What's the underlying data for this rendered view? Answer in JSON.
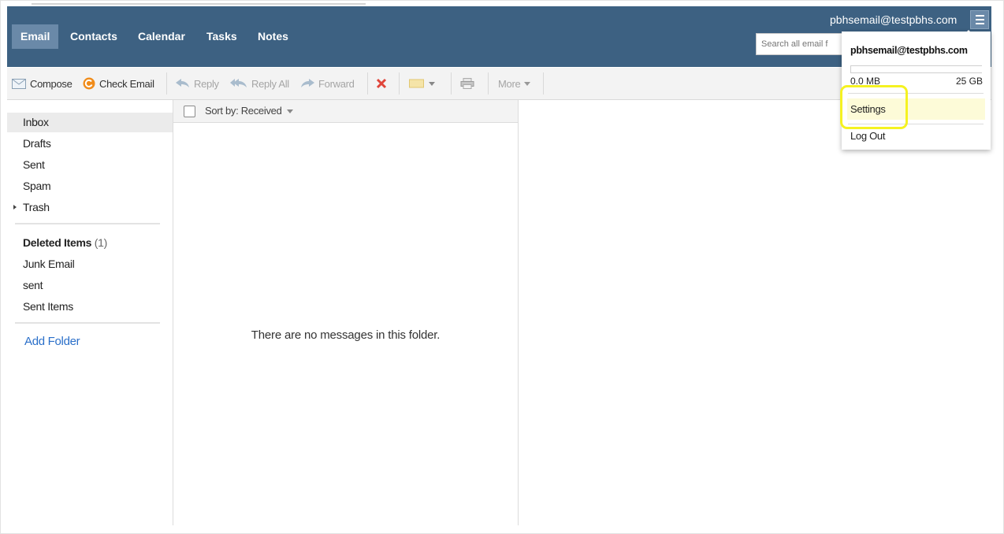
{
  "header": {
    "tabs": [
      {
        "label": "Email",
        "active": true
      },
      {
        "label": "Contacts",
        "active": false
      },
      {
        "label": "Calendar",
        "active": false
      },
      {
        "label": "Tasks",
        "active": false
      },
      {
        "label": "Notes",
        "active": false
      }
    ],
    "user_email": "pbhsemail@testpbhs.com",
    "search_placeholder": "Search all email f",
    "menu_icon": "hamburger-menu-icon",
    "colors": {
      "header_bg": "#3d6182",
      "active_tab_bg": "#6a89a8"
    }
  },
  "toolbar": {
    "compose": "Compose",
    "check_email": "Check Email",
    "reply": "Reply",
    "reply_all": "Reply All",
    "forward": "Forward",
    "more": "More"
  },
  "sidebar": {
    "folders": [
      {
        "label": "Inbox",
        "selected": true
      },
      {
        "label": "Drafts"
      },
      {
        "label": "Sent"
      },
      {
        "label": "Spam"
      },
      {
        "label": "Trash",
        "expandable": true
      }
    ],
    "custom_folders": [
      {
        "label": "Deleted Items",
        "count": "(1)",
        "bold": true
      },
      {
        "label": "Junk Email"
      },
      {
        "label": "sent"
      },
      {
        "label": "Sent Items"
      }
    ],
    "add_folder": "Add Folder"
  },
  "message_list": {
    "sort_label": "Sort by: Received",
    "empty_text": "There are no messages in this folder."
  },
  "account_menu": {
    "email": "pbhsemail@testpbhs.com",
    "storage_used": "0.0 MB",
    "storage_total": "25 GB",
    "storage_fraction": 0.0,
    "settings": "Settings",
    "logout": "Log Out",
    "highlight_color": "#f5f221"
  }
}
